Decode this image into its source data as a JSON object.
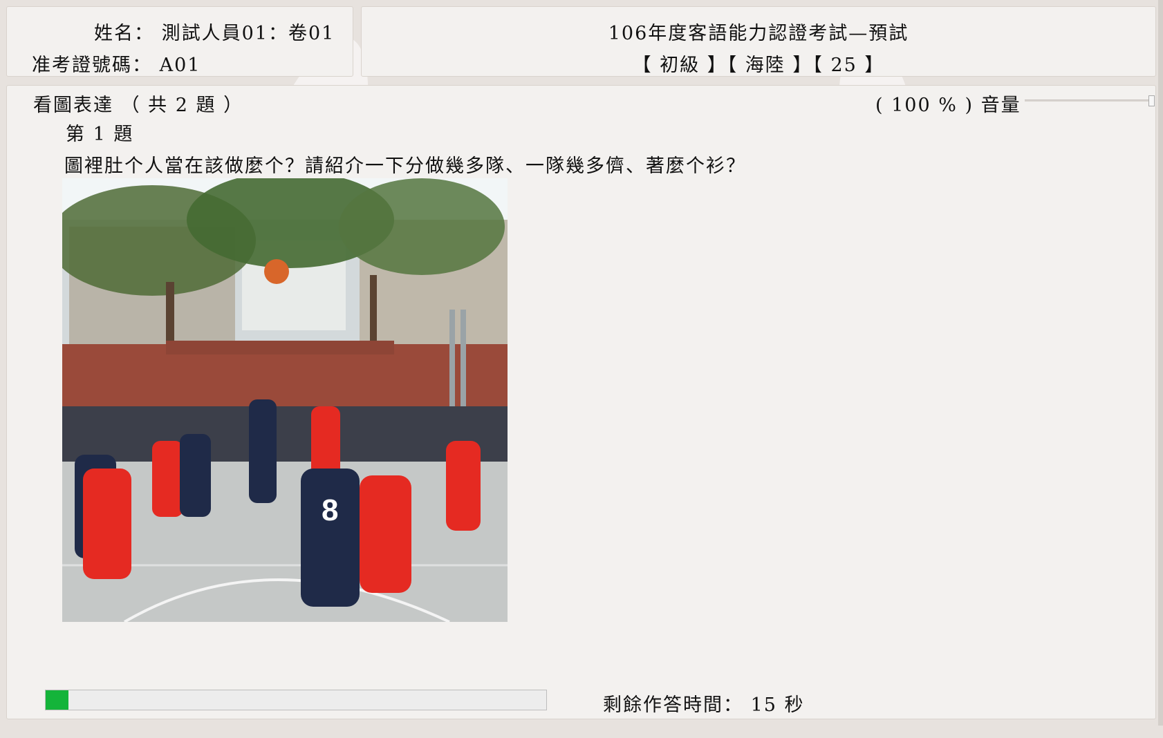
{
  "candidate": {
    "name_label": "姓名：",
    "name_value": "測試人員01：卷01",
    "id_label": "准考證號碼：",
    "id_value": "A01"
  },
  "exam": {
    "title": "106年度客語能力認證考試—預試",
    "tags": "【 初級 】【 海陸 】【 25 】"
  },
  "section": {
    "title": "看圖表達 （ 共 2 題 ）",
    "question_number": "第 1 題",
    "question_text": "圖裡肚个人當在該做麼个？請紹介一下分做幾多隊、一隊幾多儕、著麼个衫？"
  },
  "volume": {
    "display": "(  100 % ) 音量",
    "value_percent": 100
  },
  "timer": {
    "label": "剩餘作答時間：",
    "seconds": "15",
    "unit": "秒",
    "elapsed_fraction": 0.045
  },
  "colors": {
    "progress_fill": "#14b43a",
    "team_red": "#e52a22",
    "team_navy": "#1f2a48"
  }
}
